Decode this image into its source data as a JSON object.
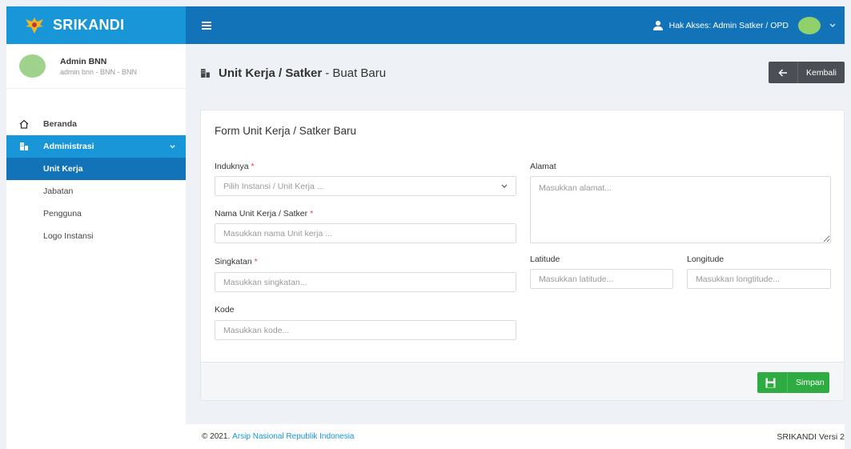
{
  "brand": {
    "title": "SRIKANDI"
  },
  "topbar": {
    "access_text": "Hak Akses: Admin Satker / OPD"
  },
  "profile": {
    "name": "Admin BNN",
    "subtitle": "admin bnn - BNN - BNN"
  },
  "sidebar": {
    "items": [
      {
        "label": "Beranda",
        "icon": "home-icon"
      },
      {
        "label": "Administrasi",
        "icon": "building-icon"
      }
    ],
    "submenu": [
      {
        "label": "Unit Kerja"
      },
      {
        "label": "Jabatan"
      },
      {
        "label": "Pengguna"
      },
      {
        "label": "Logo Instansi"
      }
    ]
  },
  "page": {
    "title_bold": "Unit Kerja / Satker",
    "title_rest": "- Buat Baru",
    "back_label": "Kembali"
  },
  "form": {
    "title": "Form Unit Kerja / Satker Baru",
    "induk_label": "Induknya",
    "induk_placeholder": "Pilih Instansi / Unit Kerja ...",
    "nama_label": "Nama Unit Kerja / Satker",
    "nama_placeholder": "Masukkan nama Unit kerja ...",
    "singkatan_label": "Singkatan",
    "singkatan_placeholder": "Masukkan singkatan...",
    "kode_label": "Kode",
    "kode_placeholder": "Masukkan kode...",
    "alamat_label": "Alamat",
    "alamat_placeholder": "Masukkan alamat...",
    "latitude_label": "Latitude",
    "latitude_placeholder": "Masukkan latitude...",
    "longitude_label": "Longitude",
    "longitude_placeholder": "Masukkan longtitude...",
    "required_mark": "*",
    "save_label": "Simpan"
  },
  "footer": {
    "copyright": "© 2021.",
    "org": "Arsip Nasional Republik Indonesia",
    "version": "SRIKANDI Versi 2"
  },
  "colors": {
    "brand_blue": "#1996d8",
    "topbar_blue": "#1373b8",
    "save_green": "#2eac42",
    "back_dark": "#4b4f55",
    "required_red": "#e73d4a"
  }
}
